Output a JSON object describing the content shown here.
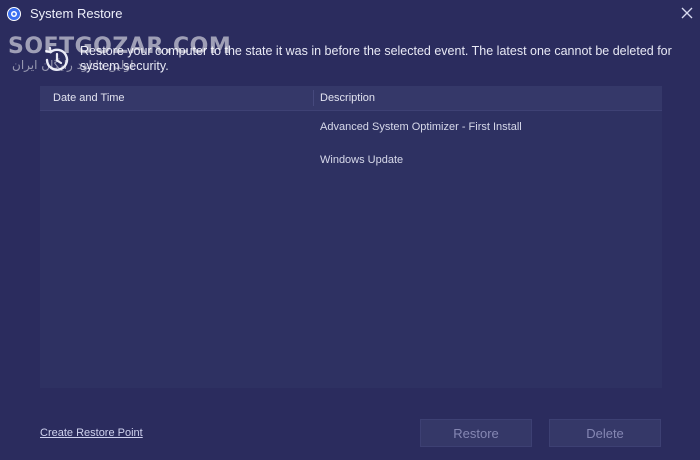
{
  "window": {
    "title": "System Restore",
    "close_glyph": "✕",
    "app_icon": "app-logo-icon"
  },
  "watermark": {
    "latin": "SOFTGOZAR.COM",
    "arabic": "اولین دانلود رایگان ایران"
  },
  "info": {
    "icon": "clock-history-icon",
    "text": "Restore your computer to the state it was in before the selected event. The latest one cannot be deleted for system security."
  },
  "table": {
    "columns": [
      "Date and Time",
      "Description"
    ],
    "rows": [
      {
        "date": "",
        "description": "Advanced System Optimizer - First Install"
      },
      {
        "date": "",
        "description": "Windows Update"
      }
    ]
  },
  "footer": {
    "create_link": "Create Restore Point",
    "restore_label": "Restore",
    "delete_label": "Delete"
  },
  "colors": {
    "background": "#2b2c5e",
    "table_background": "#2e3162",
    "header_background": "#353869",
    "button_background": "#353868",
    "disabled_text": "#8587b3"
  }
}
